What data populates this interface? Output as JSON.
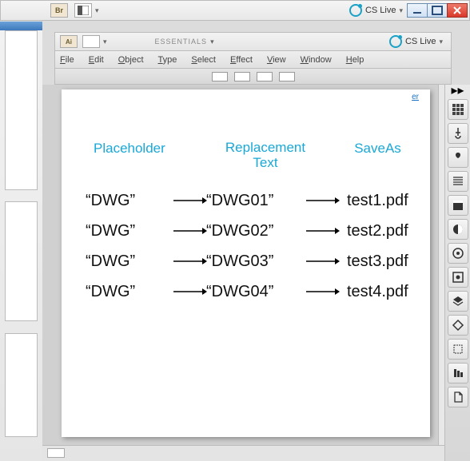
{
  "outer": {
    "br_label": "Br",
    "cs_live": "CS Live",
    "dd_glyph": "▾"
  },
  "inner": {
    "br_label": "Ai",
    "cs_live": "CS Live",
    "workspace": "ESSENTIALS",
    "dd_glyph": "▾"
  },
  "menubar": [
    "File",
    "Edit",
    "Object",
    "Type",
    "Select",
    "Effect",
    "View",
    "Window",
    "Help"
  ],
  "page_tag": "er",
  "table": {
    "headers": {
      "placeholder": "Placeholder",
      "replacement": "Replacement Text",
      "saveas": "SaveAs"
    },
    "rows": [
      {
        "placeholder": "“DWG”",
        "replacement": "“DWG01”",
        "saveas": "test1.pdf"
      },
      {
        "placeholder": "“DWG”",
        "replacement": "“DWG02”",
        "saveas": "test2.pdf"
      },
      {
        "placeholder": "“DWG”",
        "replacement": "“DWG03”",
        "saveas": "test3.pdf"
      },
      {
        "placeholder": "“DWG”",
        "replacement": "“DWG04”",
        "saveas": "test4.pdf"
      }
    ]
  },
  "right_panels": [
    "grid",
    "usb",
    "spade",
    "lines",
    "lines2",
    "contrast",
    "circle-dot",
    "circle-ring",
    "square-dot",
    "diamond",
    "diamond2",
    "crop",
    "bars",
    "page"
  ],
  "rs_toggle": "▸▸"
}
